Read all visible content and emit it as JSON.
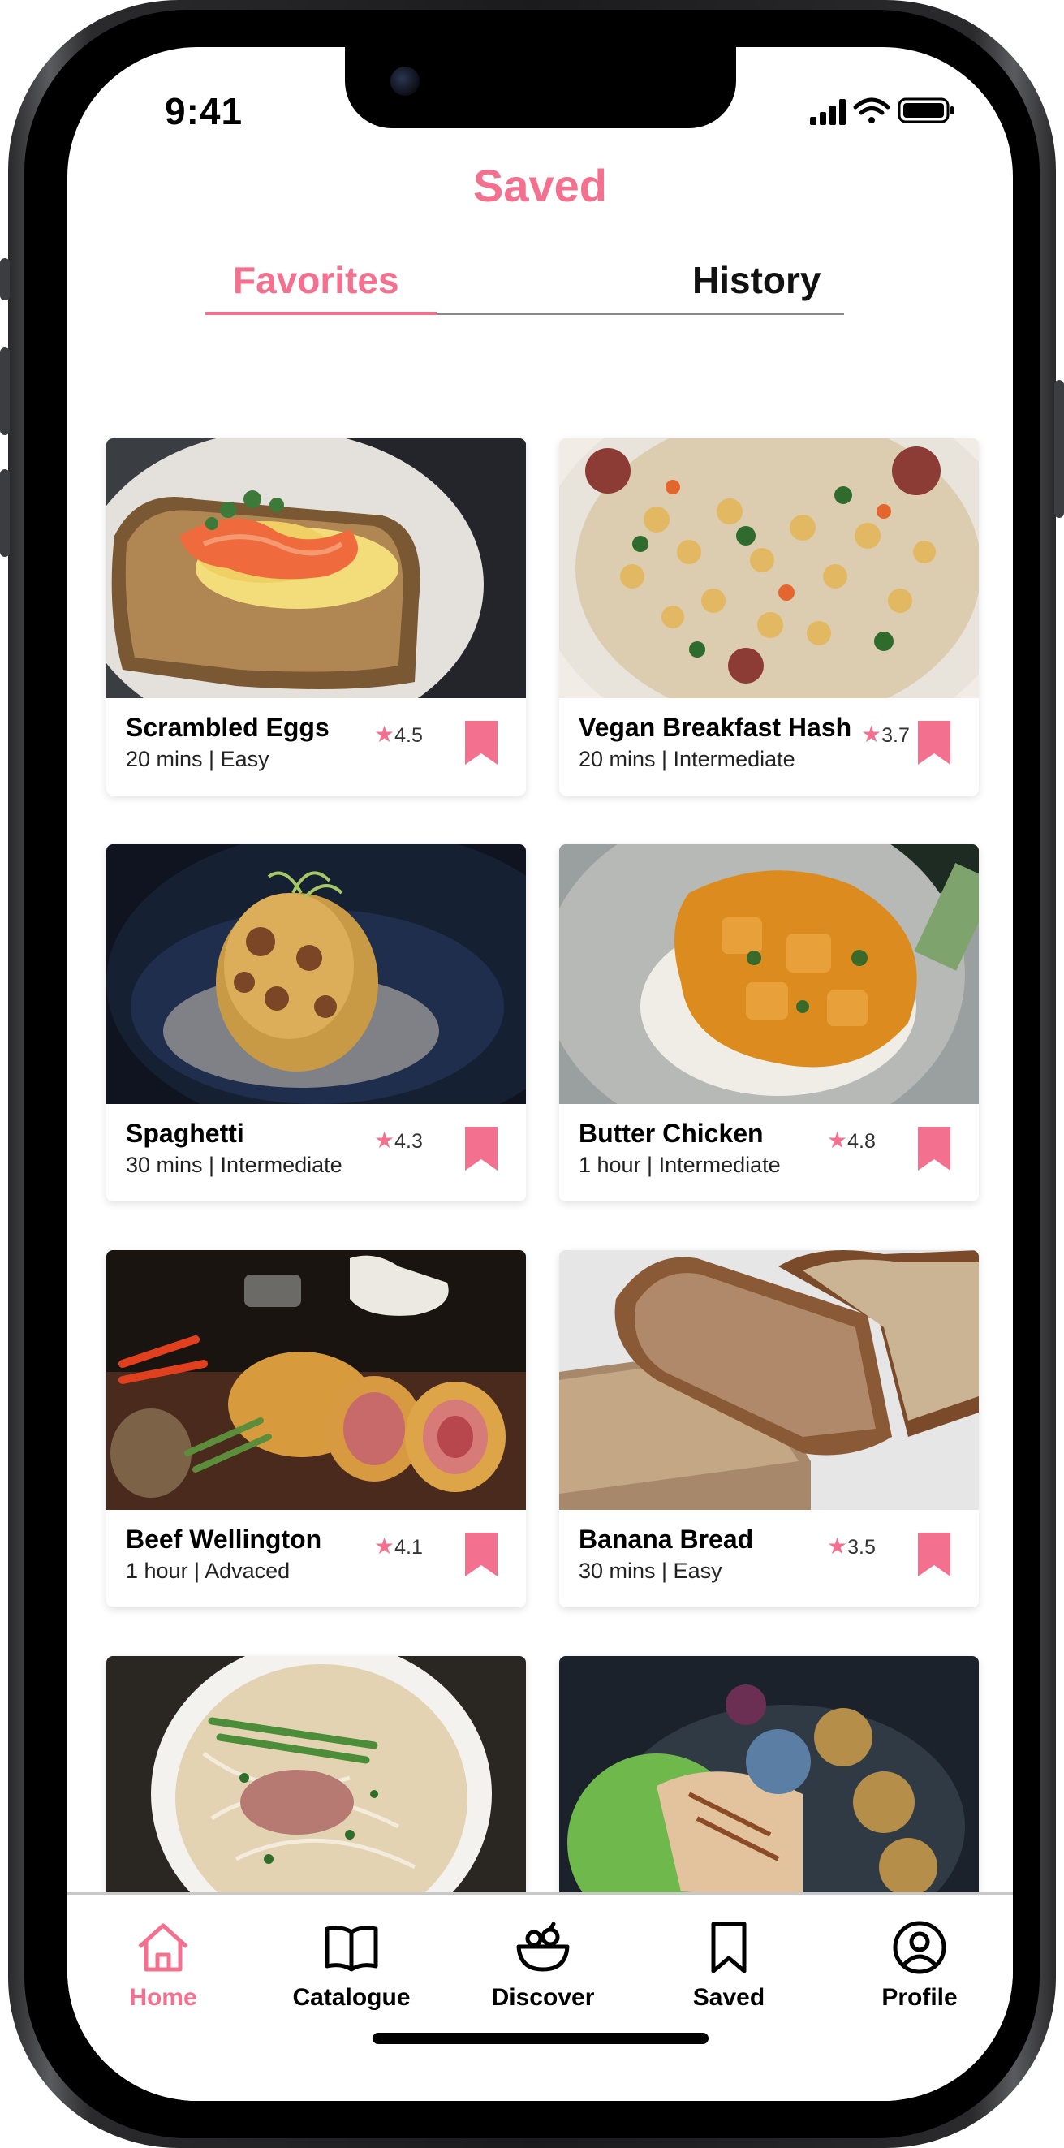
{
  "status_bar": {
    "time": "9:41"
  },
  "header": {
    "title": "Saved"
  },
  "tabs": [
    {
      "label": "Favorites",
      "active": true
    },
    {
      "label": "History",
      "active": false
    }
  ],
  "recipes": [
    {
      "name": "Scrambled Eggs",
      "meta": "20 mins | Easy",
      "rating": "4.5"
    },
    {
      "name": "Vegan Breakfast Hash",
      "meta": "20 mins | Intermediate",
      "rating": "3.7"
    },
    {
      "name": "Spaghetti",
      "meta": "30 mins | Intermediate",
      "rating": "4.3"
    },
    {
      "name": "Butter Chicken",
      "meta": "1 hour | Intermediate",
      "rating": "4.8"
    },
    {
      "name": "Beef Wellington",
      "meta": "1 hour | Advaced",
      "rating": "4.1"
    },
    {
      "name": "Banana Bread",
      "meta": "30 mins | Easy",
      "rating": "3.5"
    }
  ],
  "bottom_nav": [
    {
      "label": "Home",
      "icon": "home-icon",
      "active": true
    },
    {
      "label": "Catalogue",
      "icon": "book-icon",
      "active": false
    },
    {
      "label": "Discover",
      "icon": "bowl-icon",
      "active": false
    },
    {
      "label": "Saved",
      "icon": "bookmark-icon",
      "active": false
    },
    {
      "label": "Profile",
      "icon": "user-icon",
      "active": false
    }
  ],
  "colors": {
    "accent": "#f4708f",
    "text": "#000000",
    "divider": "#c8c8c8"
  }
}
